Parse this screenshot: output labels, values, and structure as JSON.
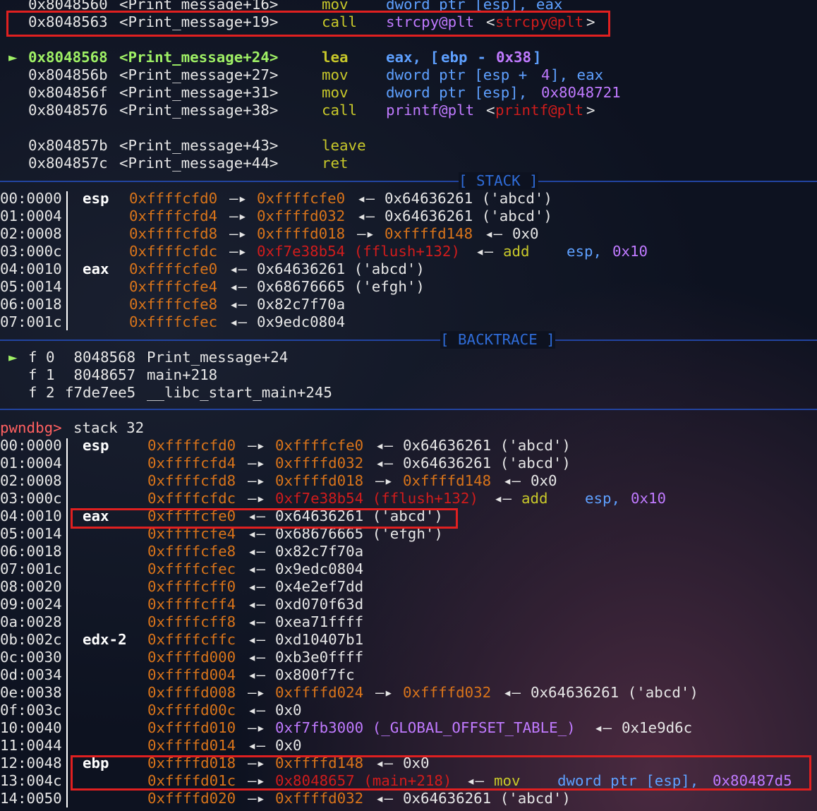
{
  "disasm": [
    {
      "addr": "0x8048560",
      "sym": "<Print_message+16>",
      "op": "mov",
      "args": "dword ptr [esp], eax"
    },
    {
      "addr": "0x8048563",
      "sym": "<Print_message+19>",
      "op": "call",
      "args": "strcpy@plt",
      "target": "strcpy@plt"
    },
    {
      "marker": "►",
      "addr": "0x8048568",
      "sym": "<Print_message+24>",
      "op": "lea",
      "args_a": "eax, [",
      "args_reg": "ebp",
      "args_b": " - ",
      "args_num": "0x38",
      "args_c": "]"
    },
    {
      "addr": "0x804856b",
      "sym": "<Print_message+27>",
      "op": "mov",
      "args_a": "dword ptr [esp + ",
      "args_num": "4",
      "args_c": "], eax"
    },
    {
      "addr": "0x804856f",
      "sym": "<Print_message+31>",
      "op": "mov",
      "args_a": "dword ptr [esp], ",
      "args_num": "0x8048721"
    },
    {
      "addr": "0x8048576",
      "sym": "<Print_message+38>",
      "op": "call",
      "args": "printf@plt",
      "target": "printf@plt"
    },
    {
      "addr": "0x804857b",
      "sym": "<Print_message+43>",
      "op": "leave"
    },
    {
      "addr": "0x804857c",
      "sym": "<Print_message+44>",
      "op": "ret"
    }
  ],
  "headers": {
    "stack": "[ STACK ]",
    "backtrace": "[ BACKTRACE ]"
  },
  "stack_top": [
    {
      "off": "00:0000",
      "reg": "esp",
      "a1": "0xffffcfd0",
      "ar1": "—▸",
      "a2": "0xffffcfe0",
      "ar2": "◂—",
      "v": "0x64636261 ('abcd')"
    },
    {
      "off": "01:0004",
      "reg": "",
      "a1": "0xffffcfd4",
      "ar1": "—▸",
      "a2": "0xffffd032",
      "ar2": "◂—",
      "v": "0x64636261 ('abcd')"
    },
    {
      "off": "02:0008",
      "reg": "",
      "a1": "0xffffcfd8",
      "ar1": "—▸",
      "a2": "0xffffd018",
      "ar2": "—▸",
      "a3": "0xffffd148",
      "ar3": "◂—",
      "v": "0x0"
    },
    {
      "off": "03:000c",
      "reg": "",
      "a1": "0xffffcfdc",
      "ar1": "—▸",
      "a2r": "0xf7e38b54 (fflush+132)",
      "ar2": "◂—",
      "ins": "add",
      "insargs": "esp,",
      "insnum": "0x10"
    },
    {
      "off": "04:0010",
      "reg": "eax",
      "a1": "0xffffcfe0",
      "ar1": "◂—",
      "v": "0x64636261 ('abcd')"
    },
    {
      "off": "05:0014",
      "reg": "",
      "a1": "0xffffcfe4",
      "ar1": "◂—",
      "v": "0x68676665 ('efgh')"
    },
    {
      "off": "06:0018",
      "reg": "",
      "a1": "0xffffcfe8",
      "ar1": "◂—",
      "v": "0x82c7f70a"
    },
    {
      "off": "07:001c",
      "reg": "",
      "a1": "0xffffcfec",
      "ar1": "◂—",
      "v": "0x9edc0804"
    }
  ],
  "backtrace": [
    {
      "marker": "►",
      "frame": "f 0",
      "addr": " 8048568",
      "fn": "Print_message+24"
    },
    {
      "marker": "",
      "frame": "f 1",
      "addr": " 8048657",
      "fn": "main+218"
    },
    {
      "marker": "",
      "frame": "f 2",
      "addr": "f7de7ee5",
      "fn": "__libc_start_main+245"
    }
  ],
  "prompt": {
    "label": "pwndbg>",
    "command": "stack 32"
  },
  "stack32": [
    {
      "off": "00:0000",
      "reg": "esp",
      "a1": "0xffffcfd0",
      "ar1": "—▸",
      "a2": "0xffffcfe0",
      "ar2": "◂—",
      "v": "0x64636261 ('abcd')"
    },
    {
      "off": "01:0004",
      "reg": "",
      "a1": "0xffffcfd4",
      "ar1": "—▸",
      "a2": "0xffffd032",
      "ar2": "◂—",
      "v": "0x64636261 ('abcd')"
    },
    {
      "off": "02:0008",
      "reg": "",
      "a1": "0xffffcfd8",
      "ar1": "—▸",
      "a2": "0xffffd018",
      "ar2": "—▸",
      "a3": "0xffffd148",
      "ar3": "◂—",
      "v": "0x0"
    },
    {
      "off": "03:000c",
      "reg": "",
      "a1": "0xffffcfdc",
      "ar1": "—▸",
      "a2r": "0xf7e38b54 (fflush+132)",
      "ar2": "◂—",
      "ins": "add",
      "insargs": "esp,",
      "insnum": "0x10"
    },
    {
      "off": "04:0010",
      "reg": "eax",
      "a1": "0xffffcfe0",
      "ar1": "◂—",
      "v": "0x64636261 ('abcd')"
    },
    {
      "off": "05:0014",
      "reg": "",
      "a1": "0xffffcfe4",
      "ar1": "◂—",
      "v": "0x68676665 ('efgh')"
    },
    {
      "off": "06:0018",
      "reg": "",
      "a1": "0xffffcfe8",
      "ar1": "◂—",
      "v": "0x82c7f70a"
    },
    {
      "off": "07:001c",
      "reg": "",
      "a1": "0xffffcfec",
      "ar1": "◂—",
      "v": "0x9edc0804"
    },
    {
      "off": "08:0020",
      "reg": "",
      "a1": "0xffffcff0",
      "ar1": "◂—",
      "v": "0x4e2ef7dd"
    },
    {
      "off": "09:0024",
      "reg": "",
      "a1": "0xffffcff4",
      "ar1": "◂—",
      "v": "0xd070f63d"
    },
    {
      "off": "0a:0028",
      "reg": "",
      "a1": "0xffffcff8",
      "ar1": "◂—",
      "v": "0xea71ffff"
    },
    {
      "off": "0b:002c",
      "reg": "edx-2",
      "a1": "0xffffcffc",
      "ar1": "◂—",
      "v": "0xd10407b1"
    },
    {
      "off": "0c:0030",
      "reg": "",
      "a1": "0xffffd000",
      "ar1": "◂—",
      "v": "0xb3e0ffff"
    },
    {
      "off": "0d:0034",
      "reg": "",
      "a1": "0xffffd004",
      "ar1": "◂—",
      "v": "0x800f7fc"
    },
    {
      "off": "0e:0038",
      "reg": "",
      "a1": "0xffffd008",
      "ar1": "—▸",
      "a2": "0xffffd024",
      "ar2": "—▸",
      "a3": "0xffffd032",
      "ar3": "◂—",
      "v": "0x64636261 ('abcd')"
    },
    {
      "off": "0f:003c",
      "reg": "",
      "a1": "0xffffd00c",
      "ar1": "◂—",
      "v": "0x0"
    },
    {
      "off": "10:0040",
      "reg": "",
      "a1": "0xffffd010",
      "ar1": "—▸",
      "a2p": "0xf7fb3000 (_GLOBAL_OFFSET_TABLE_)",
      "ar2": "◂—",
      "v": "0x1e9d6c"
    },
    {
      "off": "11:0044",
      "reg": "",
      "a1": "0xffffd014",
      "ar1": "◂—",
      "v": "0x0"
    },
    {
      "off": "12:0048",
      "reg": "ebp",
      "a1": "0xffffd018",
      "ar1": "—▸",
      "a2": "0xffffd148",
      "ar2": "◂—",
      "v": "0x0"
    },
    {
      "off": "13:004c",
      "reg": "",
      "a1": "0xffffd01c",
      "ar1": "—▸",
      "a2r": "0x8048657 (main+218)",
      "ar2": "◂—",
      "ins": "mov",
      "insargs": "dword ptr [esp],",
      "insnum": "0x80487d5"
    },
    {
      "off": "14:0050",
      "reg": "",
      "a1": "0xffffd020",
      "ar1": "—▸",
      "a2": "0xffffd032",
      "ar2": "◂—",
      "v": "0x64636261 ('abcd')"
    }
  ],
  "colors": {
    "addr_orange": "#d9741a",
    "highlight_red": "#e02020",
    "rip_green": "#9ff065",
    "reg_blue": "#5ea0ff",
    "num_purple": "#c07aff",
    "separator_blue": "#2244a0"
  }
}
